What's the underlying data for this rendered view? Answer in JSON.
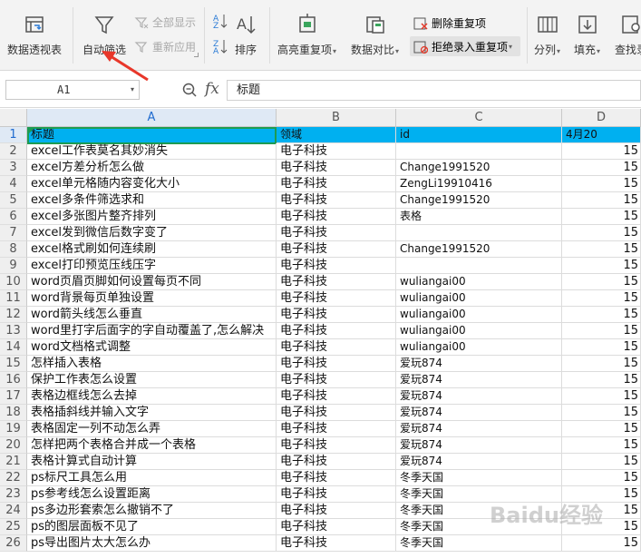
{
  "ribbon": {
    "pivot": "数据透视表",
    "autofilter": "自动筛选",
    "show_all": "全部显示",
    "reapply": "重新应用",
    "sort": "排序",
    "highlight_dup": "高亮重复项",
    "compare": "数据对比",
    "remove_dup": "删除重复项",
    "reject_dup": "拒绝录入重复项",
    "split": "分列",
    "fill": "填充",
    "find": "查找录"
  },
  "formula_bar": {
    "name_box": "A1",
    "fx": "fx",
    "value": "标题"
  },
  "columns": [
    "A",
    "B",
    "C",
    "D"
  ],
  "header_row": {
    "num": "1",
    "a": "标题",
    "b": "领域",
    "c": "id",
    "d": "4月20"
  },
  "rows": [
    {
      "num": "2",
      "a": "excel工作表莫名其妙消失",
      "b": "电子科技",
      "c": "",
      "d": "15"
    },
    {
      "num": "3",
      "a": "excel方差分析怎么做",
      "b": "电子科技",
      "c": "Change1991520",
      "d": "15"
    },
    {
      "num": "4",
      "a": "excel单元格随内容变化大小",
      "b": "电子科技",
      "c": "ZengLi19910416",
      "d": "15"
    },
    {
      "num": "5",
      "a": "excel多条件筛选求和",
      "b": "电子科技",
      "c": "Change1991520",
      "d": "15"
    },
    {
      "num": "6",
      "a": "excel多张图片整齐排列",
      "b": "电子科技",
      "c": "表格",
      "d": "15"
    },
    {
      "num": "7",
      "a": "excel发到微信后数字变了",
      "b": "电子科技",
      "c": "",
      "d": "15"
    },
    {
      "num": "8",
      "a": "excel格式刷如何连续刷",
      "b": "电子科技",
      "c": "Change1991520",
      "d": "15"
    },
    {
      "num": "9",
      "a": "excel打印预览压线压字",
      "b": "电子科技",
      "c": "",
      "d": "15"
    },
    {
      "num": "10",
      "a": "word页眉页脚如何设置每页不同",
      "b": "电子科技",
      "c": "wuliangai00",
      "d": "15"
    },
    {
      "num": "11",
      "a": "word背景每页单独设置",
      "b": "电子科技",
      "c": "wuliangai00",
      "d": "15"
    },
    {
      "num": "12",
      "a": "word箭头线怎么垂直",
      "b": "电子科技",
      "c": "wuliangai00",
      "d": "15"
    },
    {
      "num": "13",
      "a": "word里打字后面字的字自动覆盖了,怎么解决",
      "b": "电子科技",
      "c": "wuliangai00",
      "d": "15"
    },
    {
      "num": "14",
      "a": "word文档格式调整",
      "b": "电子科技",
      "c": "wuliangai00",
      "d": "15"
    },
    {
      "num": "15",
      "a": "怎样插入表格",
      "b": "电子科技",
      "c": "爱玩874",
      "d": "15"
    },
    {
      "num": "16",
      "a": "保护工作表怎么设置",
      "b": "电子科技",
      "c": "爱玩874",
      "d": "15"
    },
    {
      "num": "17",
      "a": "表格边框线怎么去掉",
      "b": "电子科技",
      "c": "爱玩874",
      "d": "15"
    },
    {
      "num": "18",
      "a": "表格插斜线并输入文字",
      "b": "电子科技",
      "c": "爱玩874",
      "d": "15"
    },
    {
      "num": "19",
      "a": "表格固定一列不动怎么弄",
      "b": "电子科技",
      "c": "爱玩874",
      "d": "15"
    },
    {
      "num": "20",
      "a": "怎样把两个表格合并成一个表格",
      "b": "电子科技",
      "c": "爱玩874",
      "d": "15"
    },
    {
      "num": "21",
      "a": "表格计算式自动计算",
      "b": "电子科技",
      "c": "爱玩874",
      "d": "15"
    },
    {
      "num": "22",
      "a": "ps标尺工具怎么用",
      "b": "电子科技",
      "c": "冬季天国",
      "d": "15"
    },
    {
      "num": "23",
      "a": "ps参考线怎么设置距离",
      "b": "电子科技",
      "c": "冬季天国",
      "d": "15"
    },
    {
      "num": "24",
      "a": "ps多边形套索怎么撤销不了",
      "b": "电子科技",
      "c": "冬季天国",
      "d": "15"
    },
    {
      "num": "25",
      "a": "ps的图层面板不见了",
      "b": "电子科技",
      "c": "冬季天国",
      "d": "15"
    },
    {
      "num": "26",
      "a": "ps导出图片太大怎么办",
      "b": "电子科技",
      "c": "冬季天国",
      "d": "15"
    }
  ],
  "colors": {
    "header_fill": "#00b0f0",
    "selection": "#1d9b52",
    "annotation_arrow": "#e8372a"
  },
  "icons": [
    "pivot-table-icon",
    "filter-icon",
    "sort-ascending-icon",
    "highlight-duplicates-icon",
    "compare-icon",
    "remove-duplicates-icon",
    "reject-duplicates-icon",
    "split-columns-icon",
    "fill-icon",
    "find-icon",
    "zoom-icon"
  ],
  "watermark": "Baidu经验"
}
